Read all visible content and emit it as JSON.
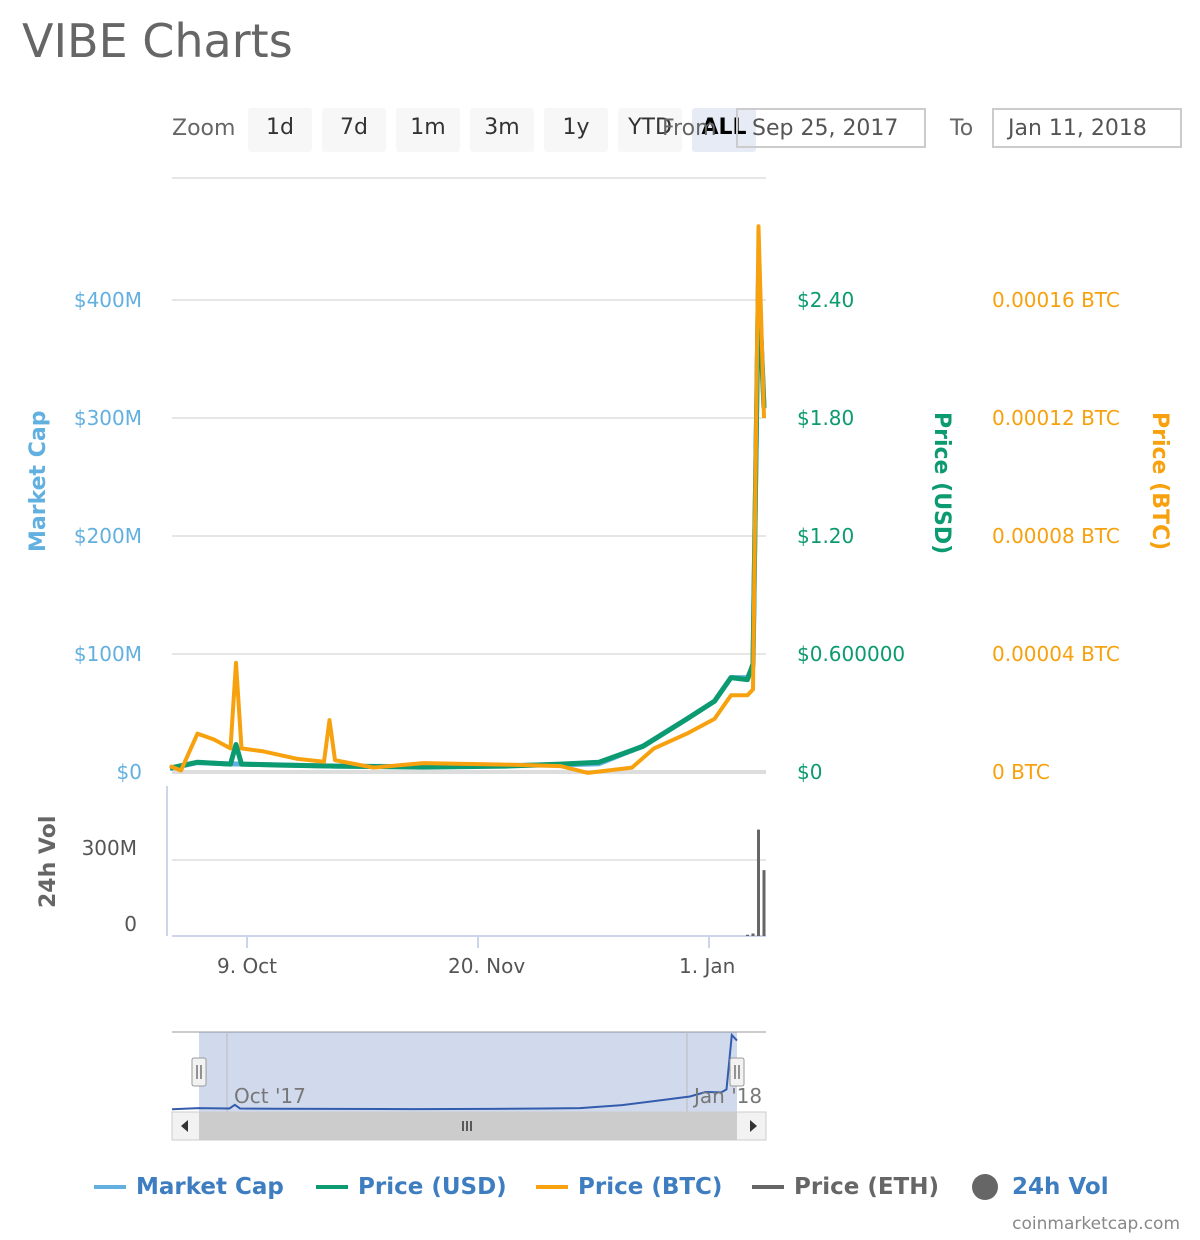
{
  "title": "VIBE Charts",
  "zoom": {
    "label": "Zoom",
    "buttons": [
      "1d",
      "7d",
      "1m",
      "3m",
      "1y",
      "YTD",
      "ALL"
    ],
    "selected": "ALL"
  },
  "range": {
    "from_label": "From",
    "from": "Sep 25, 2017",
    "to_label": "To",
    "to": "Jan 11, 2018"
  },
  "colors": {
    "market_cap": "#62b0e0",
    "price_usd": "#0c9a70",
    "price_btc": "#f7a10e",
    "price_eth": "#666666",
    "volume": "#666666"
  },
  "credit": "coinmarketcap.com",
  "chart_data": {
    "type": "line",
    "x_range": [
      "2017-09-25",
      "2018-01-11"
    ],
    "x_ticks": [
      {
        "date": "2017-10-09",
        "label": "9. Oct"
      },
      {
        "date": "2017-11-20",
        "label": "20. Nov"
      },
      {
        "date": "2018-01-01",
        "label": "1. Jan"
      }
    ],
    "axes": {
      "market_cap": {
        "label": "Market Cap",
        "ticks": [
          "$0",
          "$100M",
          "$200M",
          "$300M",
          "$400M"
        ],
        "range": [
          0,
          400000000
        ]
      },
      "price_usd": {
        "label": "Price (USD)",
        "ticks": [
          "$0",
          "$0.600000",
          "$1.20",
          "$1.80",
          "$2.40"
        ],
        "range": [
          0,
          2.4
        ]
      },
      "price_btc": {
        "label": "Price (BTC)",
        "ticks": [
          "0 BTC",
          "0.00004 BTC",
          "0.00008 BTC",
          "0.00012 BTC",
          "0.00016 BTC"
        ],
        "range": [
          0,
          0.00016
        ]
      },
      "volume": {
        "label": "24h Vol",
        "ticks": [
          "0",
          "300M"
        ],
        "range": [
          0,
          300000000
        ]
      }
    },
    "grid": true,
    "legend_position": "bottom",
    "series": [
      {
        "name": "Market Cap",
        "axis": "market_cap",
        "points": [
          [
            "2017-09-25",
            3000000
          ],
          [
            "2017-09-30",
            8000000
          ],
          [
            "2017-10-05",
            7000000
          ],
          [
            "2017-10-15",
            6000000
          ],
          [
            "2017-10-25",
            5000000
          ],
          [
            "2017-11-10",
            4500000
          ],
          [
            "2017-11-25",
            5500000
          ],
          [
            "2017-12-05",
            6000000
          ],
          [
            "2017-12-12",
            7000000
          ],
          [
            "2017-12-20",
            22000000
          ],
          [
            "2017-12-28",
            45000000
          ],
          [
            "2018-01-02",
            60000000
          ],
          [
            "2018-01-05",
            80000000
          ],
          [
            "2018-01-08",
            80000000
          ],
          [
            "2018-01-09",
            90000000
          ],
          [
            "2018-01-10",
            420000000
          ],
          [
            "2018-01-11",
            310000000
          ]
        ]
      },
      {
        "name": "Price (USD)",
        "axis": "price_usd",
        "points": [
          [
            "2017-09-25",
            0.02
          ],
          [
            "2017-09-30",
            0.05
          ],
          [
            "2017-10-06",
            0.04
          ],
          [
            "2017-10-07",
            0.14
          ],
          [
            "2017-10-08",
            0.04
          ],
          [
            "2017-10-15",
            0.035
          ],
          [
            "2017-10-25",
            0.03
          ],
          [
            "2017-11-10",
            0.025
          ],
          [
            "2017-11-25",
            0.03
          ],
          [
            "2017-12-05",
            0.04
          ],
          [
            "2017-12-12",
            0.05
          ],
          [
            "2017-12-20",
            0.13
          ],
          [
            "2017-12-28",
            0.27
          ],
          [
            "2018-01-02",
            0.36
          ],
          [
            "2018-01-05",
            0.48
          ],
          [
            "2018-01-08",
            0.47
          ],
          [
            "2018-01-09",
            0.55
          ],
          [
            "2018-01-10",
            2.5
          ],
          [
            "2018-01-11",
            1.85
          ]
        ]
      },
      {
        "name": "Price (BTC)",
        "axis": "price_btc",
        "points": [
          [
            "2017-09-25",
            2e-06
          ],
          [
            "2017-09-27",
            5e-07
          ],
          [
            "2017-09-30",
            1.3e-05
          ],
          [
            "2017-10-03",
            1.1e-05
          ],
          [
            "2017-10-06",
            8e-06
          ],
          [
            "2017-10-07",
            3.7e-05
          ],
          [
            "2017-10-08",
            8e-06
          ],
          [
            "2017-10-12",
            7e-06
          ],
          [
            "2017-10-18",
            4.5e-06
          ],
          [
            "2017-10-23",
            3.5e-06
          ],
          [
            "2017-10-24",
            1.76e-05
          ],
          [
            "2017-10-25",
            4e-06
          ],
          [
            "2017-11-01",
            1.5e-06
          ],
          [
            "2017-11-10",
            3e-06
          ],
          [
            "2017-11-25",
            2.5e-06
          ],
          [
            "2017-12-05",
            2e-06
          ],
          [
            "2017-12-10",
            -3e-07
          ],
          [
            "2017-12-18",
            1.5e-06
          ],
          [
            "2017-12-22",
            8e-06
          ],
          [
            "2017-12-28",
            1.3e-05
          ],
          [
            "2018-01-02",
            1.8e-05
          ],
          [
            "2018-01-05",
            2.6e-05
          ],
          [
            "2018-01-08",
            2.6e-05
          ],
          [
            "2018-01-09",
            2.8e-05
          ],
          [
            "2018-01-10",
            0.000185
          ],
          [
            "2018-01-11",
            0.00012
          ]
        ]
      },
      {
        "name": "Price (ETH)",
        "axis": "price_usd",
        "points": []
      },
      {
        "name": "24h Vol",
        "axis": "volume",
        "type": "column",
        "points": [
          [
            "2018-01-08",
            5000000
          ],
          [
            "2018-01-09",
            10000000
          ],
          [
            "2018-01-10",
            420000000
          ],
          [
            "2018-01-11",
            260000000
          ]
        ]
      }
    ],
    "navigator": {
      "labels": [
        "Oct '17",
        "Jan '18"
      ],
      "selection": [
        "2017-09-25",
        "2018-01-11"
      ]
    }
  }
}
